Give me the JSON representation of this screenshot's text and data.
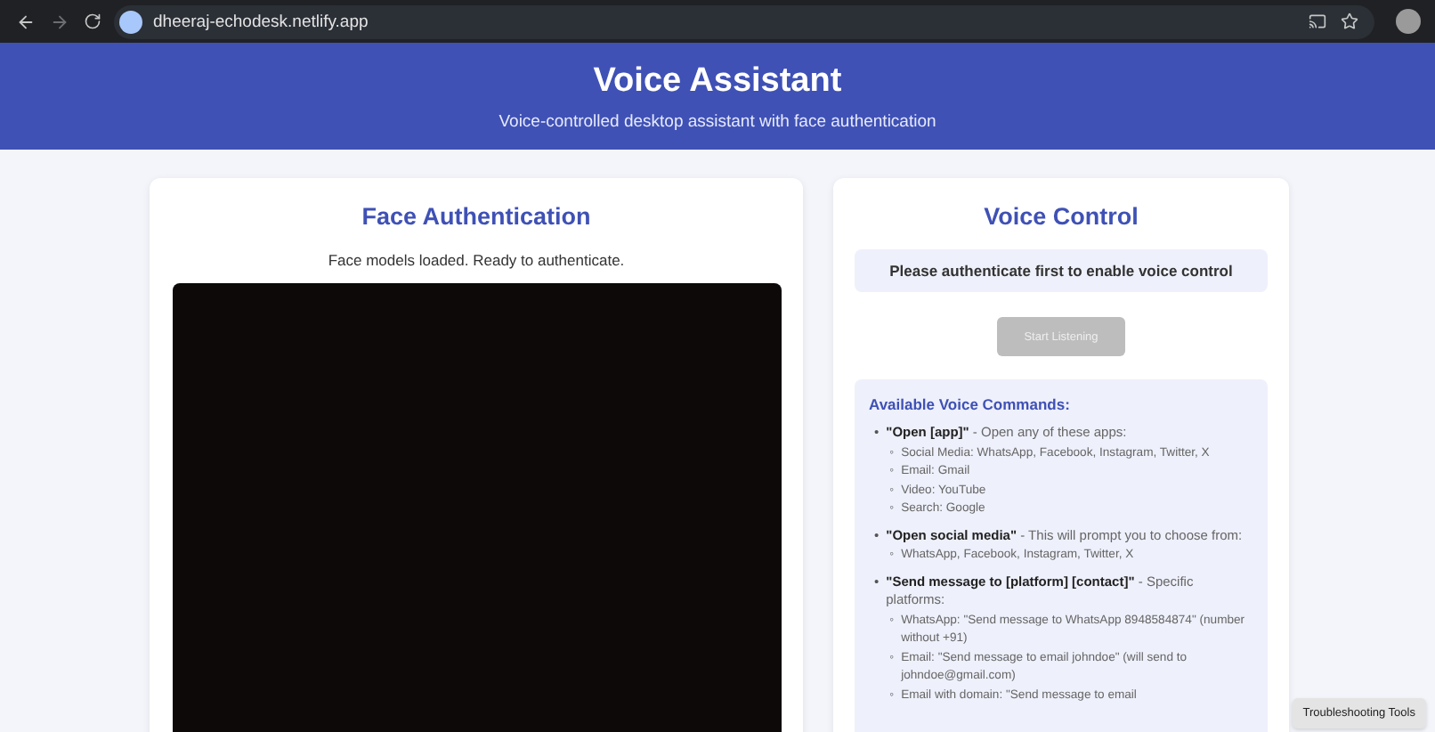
{
  "browser": {
    "url": "dheeraj-echodesk.netlify.app",
    "forward_disabled": true
  },
  "header": {
    "title": "Voice Assistant",
    "subtitle": "Voice-controlled desktop assistant with face authentication"
  },
  "face_auth": {
    "title": "Face Authentication",
    "status": "Face models loaded. Ready to authenticate."
  },
  "voice_control": {
    "title": "Voice Control",
    "notice": "Please authenticate first to enable voice control",
    "button": {
      "label": "Start Listening",
      "disabled": true
    },
    "commands_title": "Available Voice Commands:",
    "commands": [
      {
        "marker": "•",
        "text": "**\"Open [app]\"** - Open any of these apps:",
        "children": [
          {
            "marker": "◦",
            "text": "Social Media: WhatsApp, Facebook, Instagram, Twitter, X"
          },
          {
            "marker": "◦",
            "text": "Email: Gmail"
          },
          {
            "marker": "◦",
            "text": "Video: YouTube"
          },
          {
            "marker": "◦",
            "text": "Search: Google"
          }
        ]
      },
      {
        "marker": "•",
        "text": "**\"Open social media\"** - This will prompt you to choose from:",
        "children": [
          {
            "marker": "◦",
            "text": "WhatsApp, Facebook, Instagram, Twitter, X"
          }
        ]
      },
      {
        "marker": "•",
        "text": "**\"Send message to [platform] [contact]\"** - Specific platforms:",
        "children": [
          {
            "marker": "◦",
            "text": "WhatsApp: \"Send message to WhatsApp 8948584874\" (number without +91)"
          },
          {
            "marker": "◦",
            "text": "Email: \"Send message to email johndoe\" (will send to johndoe@gmail.com)"
          },
          {
            "marker": "◦",
            "text": "Email with domain: \"Send message to email"
          }
        ]
      }
    ]
  },
  "troubleshooting_button": "Troubleshooting Tools"
}
